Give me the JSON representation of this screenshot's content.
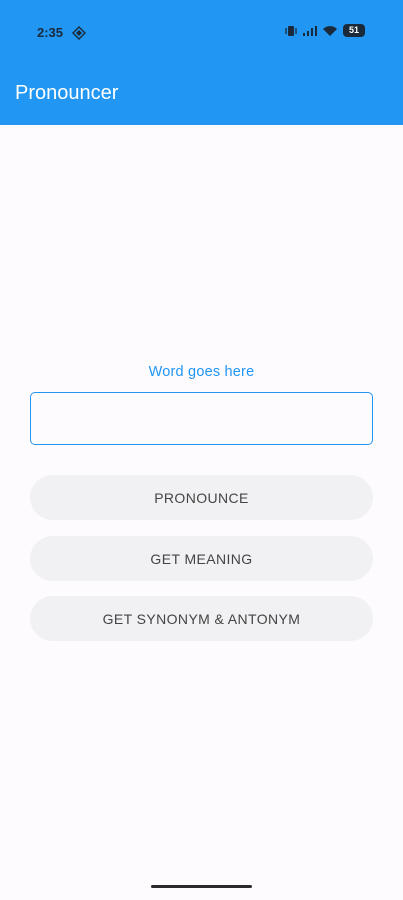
{
  "status_bar": {
    "time": "2:35",
    "battery": "51",
    "icons": [
      "diamond-icon",
      "vibrate-icon",
      "signal-icon",
      "wifi-icon",
      "battery-icon"
    ]
  },
  "app_bar": {
    "title": "Pronouncer",
    "color": "#2196f3"
  },
  "form": {
    "label": "Word goes here",
    "input_value": "",
    "accent_color": "#2196f3"
  },
  "buttons": {
    "pronounce": "PRONOUNCE",
    "meaning": "GET MEANING",
    "synonym": "GET SYNONYM & ANTONYM"
  }
}
